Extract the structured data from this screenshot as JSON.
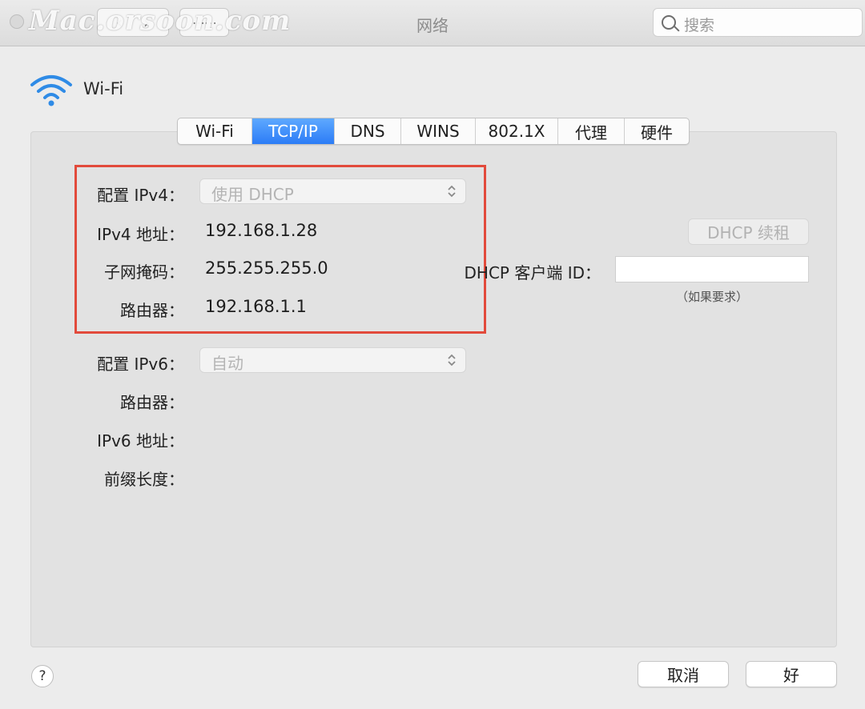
{
  "window": {
    "title": "网络",
    "watermark": "Mac.orsoon.com"
  },
  "search": {
    "placeholder": "搜索"
  },
  "service": {
    "name": "Wi-Fi"
  },
  "tabs": [
    {
      "label": "Wi-Fi",
      "active": false
    },
    {
      "label": "TCP/IP",
      "active": true
    },
    {
      "label": "DNS",
      "active": false
    },
    {
      "label": "WINS",
      "active": false
    },
    {
      "label": "802.1X",
      "active": false
    },
    {
      "label": "代理",
      "active": false
    },
    {
      "label": "硬件",
      "active": false
    }
  ],
  "ipv4": {
    "config_label": "配置 IPv4：",
    "config_value": "使用 DHCP",
    "address_label": "IPv4 地址：",
    "address_value": "192.168.1.28",
    "subnet_label": "子网掩码：",
    "subnet_value": "255.255.255.0",
    "router_label": "路由器：",
    "router_value": "192.168.1.1"
  },
  "dhcp": {
    "renew_label": "DHCP 续租",
    "client_id_label": "DHCP 客户端 ID：",
    "client_id_value": "",
    "hint": "（如果要求）"
  },
  "ipv6": {
    "config_label": "配置 IPv6：",
    "config_value": "自动",
    "router_label": "路由器：",
    "address_label": "IPv6 地址：",
    "prefix_label": "前缀长度："
  },
  "footer": {
    "help": "?",
    "cancel": "取消",
    "ok": "好"
  },
  "colors": {
    "accent": "#2c7cf6",
    "highlight": "#e24a3b"
  }
}
